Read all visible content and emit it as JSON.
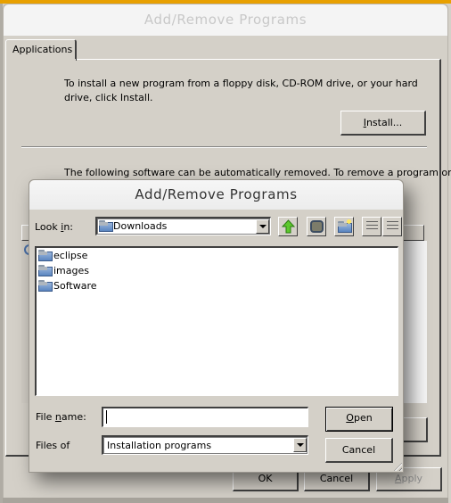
{
  "back_window": {
    "title": "Add/Remove Programs",
    "tabs": [
      {
        "label": "Applications"
      }
    ],
    "install_text": "To install a new program from a floppy disk, CD-ROM drive, or your hard drive, click Install.",
    "install_button": {
      "label_accel": "I",
      "label_rest": "nstall..."
    },
    "remove_text": "The following software can be automatically removed. To remove a program or",
    "buttons": {
      "ok": "OK",
      "cancel": "Cancel",
      "apply_accel": "A",
      "apply_rest": "pply"
    }
  },
  "dialog": {
    "title": "Add/Remove Programs",
    "look_in": {
      "label_pre": "Look ",
      "label_accel": "i",
      "label_post": "n:",
      "value": "Downloads"
    },
    "toolbar": {
      "icons": [
        "up-folder-icon",
        "desktop-icon",
        "new-folder-icon",
        "list-view-icon",
        "details-view-icon"
      ]
    },
    "files": [
      {
        "name": "eclipse",
        "icon": "folder-icon"
      },
      {
        "name": "images",
        "icon": "folder-icon"
      },
      {
        "name": "Software",
        "icon": "folder-icon"
      }
    ],
    "file_name": {
      "label_pre": "File ",
      "label_accel": "n",
      "label_post": "ame:",
      "value": ""
    },
    "files_of_type": {
      "label": "Files of",
      "value": "Installation programs"
    },
    "open_button": {
      "label_accel": "O",
      "label_rest": "pen"
    },
    "cancel_button": {
      "label": "Cancel"
    }
  },
  "colors": {
    "accent_strip": "#e8a000",
    "face": "#d4d0c8"
  }
}
